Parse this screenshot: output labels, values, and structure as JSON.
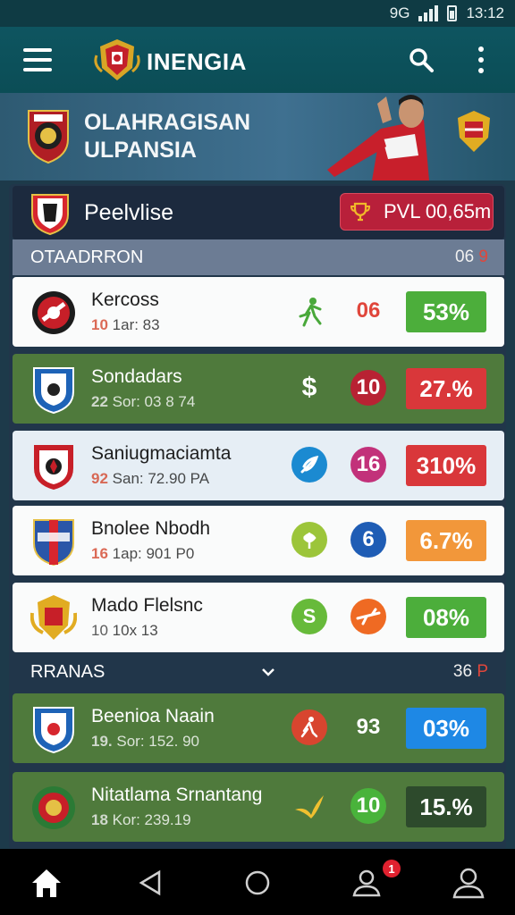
{
  "status_bar": {
    "network": "9G",
    "time": "13:12"
  },
  "app_bar": {
    "title": "INENGIA"
  },
  "hero": {
    "title_line1": "OLAHRAGISAN",
    "title_line2": "ULPANSIA"
  },
  "league": {
    "name": "Peelvlise",
    "price": "PVL 00,65m"
  },
  "sections": [
    {
      "label": "OTAADRRON",
      "count": "06",
      "count_suffix": "9"
    },
    {
      "label": "RRANAS",
      "count": "36",
      "count_suffix": "P"
    }
  ],
  "teams": [
    {
      "name": "Kercoss",
      "num": "10",
      "sub": "1ar: 83",
      "act2": "06",
      "pct": "53%",
      "pct_color": "#4cae3b",
      "style": "white"
    },
    {
      "name": "Sondadars",
      "num": "22",
      "sub": "Sor: 03 8 74",
      "act2": "10",
      "pct": "27.%",
      "pct_color": "#d9373a",
      "style": "green"
    },
    {
      "name": "Saniugmaciamta",
      "num": "92",
      "sub": "San: 72.90 PA",
      "act2": "16",
      "pct": "310%",
      "pct_color": "#d9373a",
      "style": "lightblue"
    },
    {
      "name": "Bnolee Nbodh",
      "num": "16",
      "sub": "1ap: 901 P0",
      "act2": "6",
      "pct": "6.7%",
      "pct_color": "#f2973a",
      "style": "white"
    },
    {
      "name": "Mado Flelsnc",
      "num": "10",
      "sub": "10x 13",
      "act2": "",
      "pct": "08%",
      "pct_color": "#4cae3b",
      "style": "white"
    },
    {
      "name": "Beenioa Naain",
      "num": "19.",
      "sub": "Sor: 152. 90",
      "act2": "93",
      "pct": "03%",
      "pct_color": "#1e88e5",
      "style": "green"
    },
    {
      "name": "Nitatlama Srnantang",
      "num": "18",
      "sub": "Kor: 239.19",
      "act2": "10",
      "pct": "15.%",
      "pct_color": "#2d4a2c",
      "style": "green"
    }
  ],
  "icons": {
    "dollar": "$",
    "s_coin": "S"
  },
  "nav": {
    "notifications": "1"
  },
  "colors": {
    "accent": "#0e5560",
    "green_row": "#4f7a3c",
    "badge_red": "#b8203a"
  }
}
